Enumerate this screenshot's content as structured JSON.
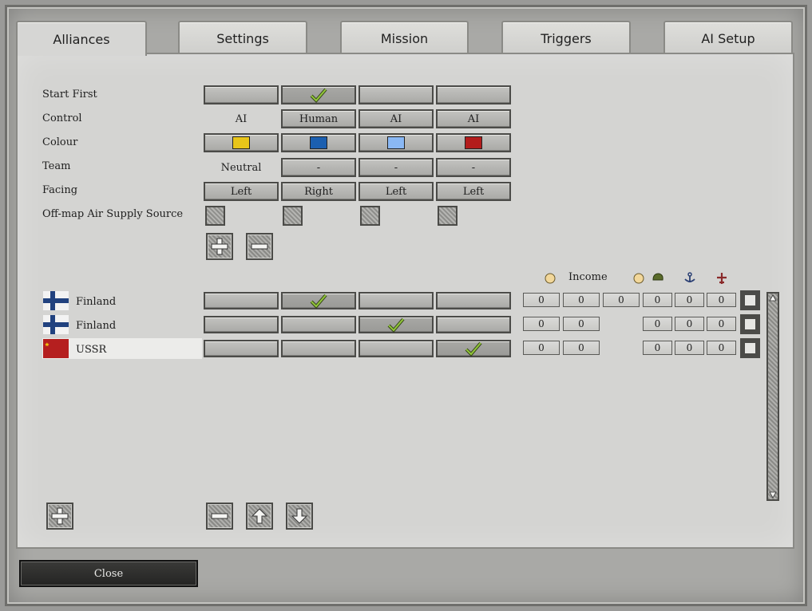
{
  "tabs": [
    {
      "label": "Alliances",
      "active": true
    },
    {
      "label": "Settings",
      "active": false
    },
    {
      "label": "Mission",
      "active": false
    },
    {
      "label": "Triggers",
      "active": false
    },
    {
      "label": "AI Setup",
      "active": false
    }
  ],
  "settings": {
    "labels": {
      "start_first": "Start First",
      "control": "Control",
      "colour": "Colour",
      "team": "Team",
      "facing": "Facing",
      "air_supply": "Off-map Air Supply Source"
    },
    "start_first_selected": 1,
    "control": [
      "AI",
      "Human",
      "AI",
      "AI"
    ],
    "colours": [
      "#e8c51a",
      "#1b5fb0",
      "#8ab8f4",
      "#b31c1c"
    ],
    "team": [
      "Neutral",
      "-",
      "-",
      "-"
    ],
    "facing": [
      "Left",
      "Right",
      "Left",
      "Left"
    ]
  },
  "resources": {
    "income_label": "Income"
  },
  "players": [
    {
      "name": "Finland",
      "flag": "finland-flag",
      "alliance": 1,
      "values": [
        "0",
        "0",
        "0",
        "0",
        "0",
        "0"
      ]
    },
    {
      "name": "Finland",
      "flag": "finland-flag",
      "alliance": 2,
      "values": [
        "0",
        "0",
        "",
        "0",
        "0",
        "0"
      ]
    },
    {
      "name": "USSR",
      "flag": "ussr-flag",
      "alliance": 3,
      "values": [
        "0",
        "0",
        "",
        "0",
        "0",
        "0"
      ]
    }
  ],
  "footer": {
    "close_label": "Close"
  }
}
